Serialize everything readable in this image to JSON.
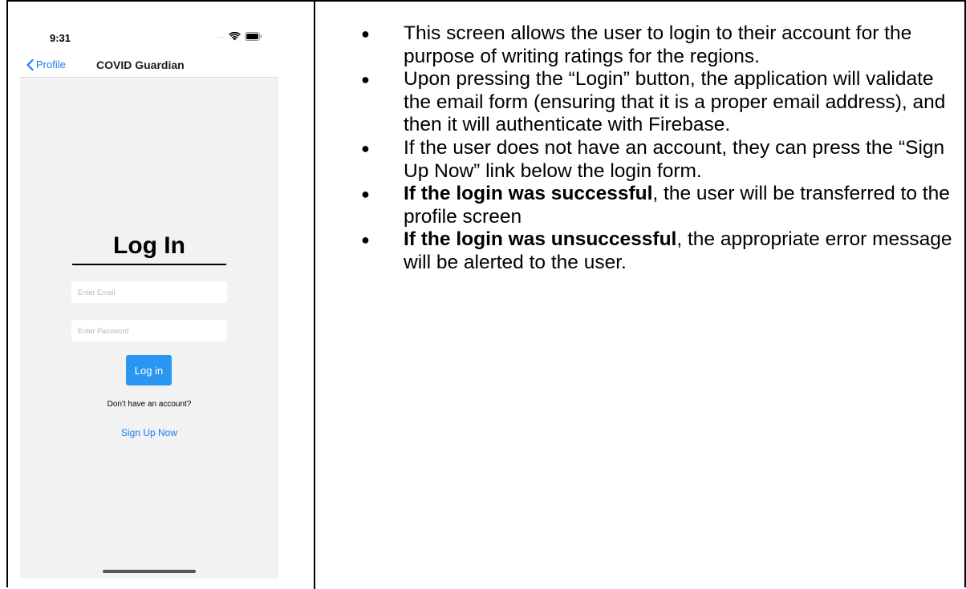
{
  "status_bar": {
    "time": "9:31",
    "signal_dots": "....",
    "icons": [
      "wifi-icon",
      "battery-icon"
    ]
  },
  "nav": {
    "back_label": "Profile",
    "title": "COVID Guardian"
  },
  "login": {
    "title": "Log In",
    "email_placeholder": "Enter Email",
    "password_placeholder": "Enter Password",
    "button_label": "Log in",
    "no_account_text": "Don't have an account?",
    "signup_label": "Sign Up Now"
  },
  "colors": {
    "accent": "#1a7cf5",
    "button": "#2a96f3",
    "background": "#f2f2f2"
  },
  "description": {
    "bullets": [
      {
        "bold": "",
        "text": "This screen allows the user to login to their account for the purpose of writing ratings for the regions."
      },
      {
        "bold": "",
        "text": "Upon pressing the “Login” button, the application will validate the email form (ensuring that it is a proper email address), and then it will authenticate with Firebase."
      },
      {
        "bold": "",
        "text": "If the user does not have an account, they can press the “Sign Up Now” link below the login form."
      },
      {
        "bold": "If the login was successful",
        "text": ", the user will be transferred to the profile screen"
      },
      {
        "bold": "If the login was unsuccessful",
        "text": ", the appropriate error message will be alerted to the user."
      }
    ]
  }
}
